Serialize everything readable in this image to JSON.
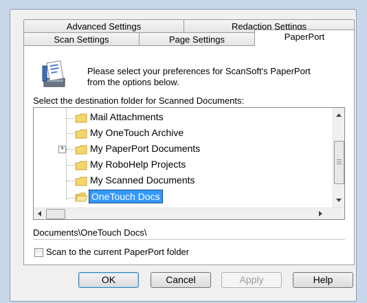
{
  "tabs": {
    "row1": [
      "Advanced Settings",
      "Redaction Settings"
    ],
    "row2": [
      "Scan Settings",
      "Page Settings",
      "PaperPort"
    ]
  },
  "intro_text_1": "Please select your preferences for ScanSoft's PaperPort",
  "intro_text_2": "from the options below.",
  "folder_label": "Select the destination folder for Scanned Documents:",
  "folders": [
    {
      "label": "Mail Attachments",
      "expandable": false,
      "selected": false
    },
    {
      "label": "My OneTouch Archive",
      "expandable": false,
      "selected": false
    },
    {
      "label": "My PaperPort Documents",
      "expandable": true,
      "selected": false
    },
    {
      "label": "My RoboHelp Projects",
      "expandable": false,
      "selected": false
    },
    {
      "label": "My Scanned Documents",
      "expandable": false,
      "selected": false
    },
    {
      "label": "OneTouch Docs",
      "expandable": false,
      "selected": true
    }
  ],
  "path_text": "Documents\\OneTouch Docs\\",
  "checkbox": {
    "label": "Scan to the current PaperPort folder",
    "checked": false
  },
  "buttons": {
    "ok": "OK",
    "cancel": "Cancel",
    "apply": "Apply",
    "help": "Help"
  },
  "colors": {
    "selection": "#3399ff",
    "folder": "#f5d66b"
  }
}
